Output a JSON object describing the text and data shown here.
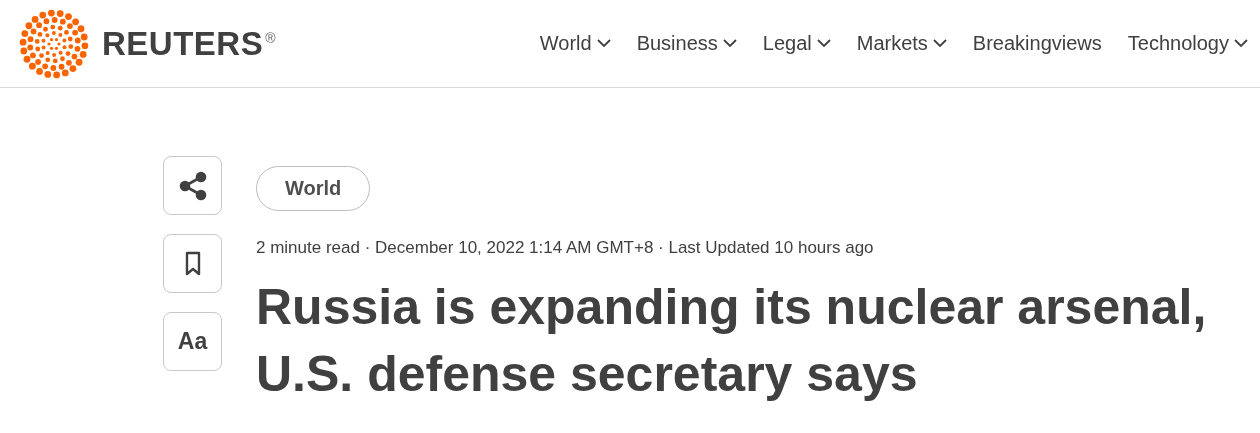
{
  "header": {
    "logo": {
      "wordmark": "REUTERS",
      "registered": "®"
    },
    "nav": [
      {
        "label": "World",
        "has_menu": true
      },
      {
        "label": "Business",
        "has_menu": true
      },
      {
        "label": "Legal",
        "has_menu": true
      },
      {
        "label": "Markets",
        "has_menu": true
      },
      {
        "label": "Breakingviews",
        "has_menu": false
      },
      {
        "label": "Technology",
        "has_menu": true
      }
    ]
  },
  "article_tools": [
    {
      "kind": "share"
    },
    {
      "kind": "bookmark"
    },
    {
      "kind": "text_size",
      "label": "Aa"
    }
  ],
  "article": {
    "section_tag": "World",
    "meta": "2 minute read · December 10, 2022 1:14 AM GMT+8 · Last Updated 10 hours ago",
    "headline": "Russia is expanding its nuclear arsenal, U.S. defense secretary says"
  }
}
